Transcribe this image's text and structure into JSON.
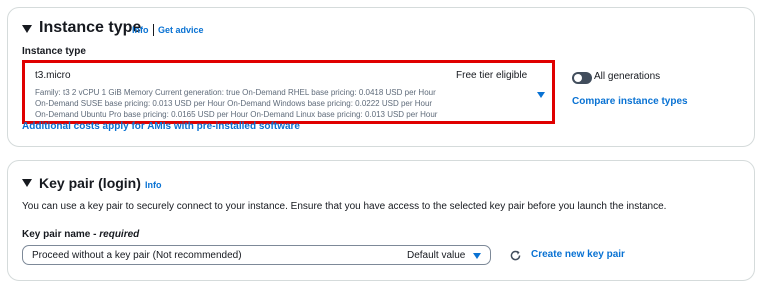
{
  "instance_type_section": {
    "heading": "Instance type",
    "info_link": "Info",
    "advice_link": "Get advice",
    "field_label": "Instance type",
    "selected": {
      "name": "t3.micro",
      "badge": "Free tier eligible",
      "details_line1": "Family: t3    2 vCPU    1 GiB Memory    Current generation: true    On-Demand RHEL base pricing: 0.0418 USD per Hour",
      "details_line2": "On-Demand SUSE base pricing: 0.013 USD per Hour    On-Demand Windows base pricing: 0.0222 USD per Hour",
      "details_line3": "On-Demand Ubuntu Pro base pricing: 0.0165 USD per Hour    On-Demand Linux base pricing: 0.013 USD per Hour"
    },
    "all_generations_label": "All generations",
    "all_generations_on": false,
    "compare_link": "Compare instance types",
    "additional_costs_link": "Additional costs apply for AMIs with pre-installed software"
  },
  "key_pair_section": {
    "heading": "Key pair (login)",
    "info_link": "Info",
    "description": "You can use a key pair to securely connect to your instance. Ensure that you have access to the selected key pair before you launch the instance.",
    "field_label": "Key pair name - ",
    "field_required": "required",
    "selected_value": "Proceed without a key pair (Not recommended)",
    "default_tag": "Default value",
    "create_link": "Create new key pair"
  },
  "colors": {
    "link": "#0972d3",
    "highlight_border": "#e00000",
    "text": "#16191f",
    "muted": "#5f6b7a"
  }
}
